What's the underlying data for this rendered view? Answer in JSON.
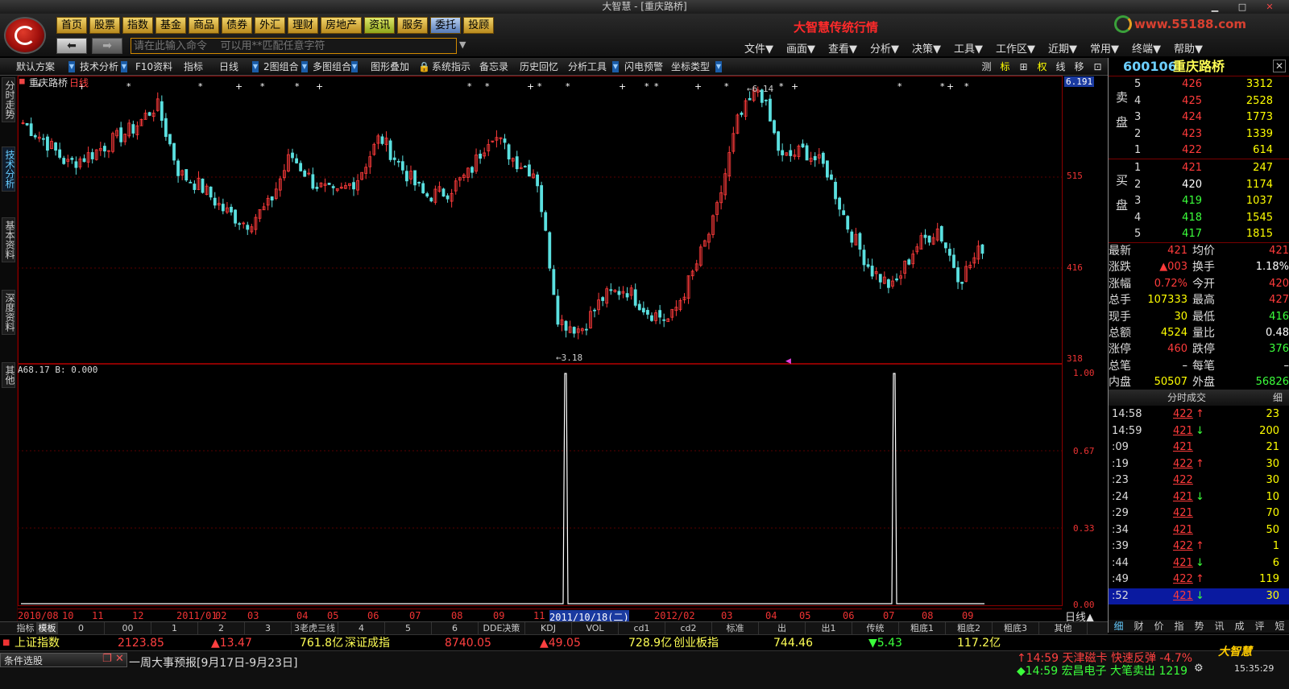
{
  "window": {
    "title": "大智慧 - [重庆路桥]"
  },
  "header": {
    "nav": [
      "首页",
      "股票",
      "指数",
      "基金",
      "商品",
      "债券",
      "外汇",
      "理财",
      "房地产",
      "资讯",
      "服务",
      "委托",
      "投顾"
    ],
    "command_placeholder": "请在此输入命令    可以用**匹配任意字符",
    "brand_title": "大智慧传统行情",
    "site": "www.55188.com",
    "menu": [
      "文件▼",
      "画面▼",
      "查看▼",
      "分析▼",
      "决策▼",
      "工具▼",
      "工作区▼",
      "近期▼",
      "常用▼",
      "终端▼",
      "帮助▼"
    ]
  },
  "toolbar": {
    "items": [
      "默认方案",
      "技术分析",
      "F10资料",
      "指标",
      "日线",
      "2图组合",
      "多图组合",
      "图形叠加",
      "系统指示",
      "备忘录",
      "历史回忆",
      "分析工具",
      "闪电预警",
      "坐标类型"
    ],
    "right_items": [
      "测",
      "标",
      "⊞",
      "权",
      "线",
      "移",
      "⊡",
      "◧"
    ]
  },
  "side_tabs": [
    "分时走势",
    "技术分析",
    "基本资料",
    "深度资料",
    "其他"
  ],
  "chart": {
    "stock_label": "重庆路桥",
    "period_label": "日线",
    "price_axis": [
      "6.191",
      "515",
      "416",
      "318"
    ],
    "high_label": "6.14",
    "low_label": "3.18",
    "indicator_label": "A68.17 B: 0.000",
    "indicator_axis": [
      "1.00",
      "0.67",
      "0.33",
      "0.00"
    ],
    "dates": [
      "2010/08",
      "10",
      "11",
      "12",
      "2011/01",
      "02",
      "03",
      "04",
      "05",
      "06",
      "07",
      "08",
      "09",
      "11",
      "2011/10/18(二)",
      "2012/02",
      "03",
      "04",
      "05",
      "06",
      "07",
      "08",
      "09"
    ],
    "bottom_period": "日线▲"
  },
  "chart_data": {
    "type": "candlestick",
    "title": "重庆路桥 日线",
    "x_range": [
      "2010/08",
      "2012/09"
    ],
    "price_range_shown": [
      3.18,
      6.191
    ],
    "marked_high": 6.14,
    "marked_low": 3.18,
    "y_ticks": [
      "6.191",
      "515",
      "416",
      "318"
    ],
    "close_points": [
      5.75,
      5.55,
      5.3,
      5.4,
      5.55,
      5.7,
      5.95,
      5.2,
      5.05,
      4.8,
      4.65,
      4.85,
      5.4,
      5.1,
      4.95,
      5.15,
      5.6,
      5.25,
      4.95,
      5.0,
      5.2,
      5.65,
      5.35,
      5.2,
      3.6,
      3.5,
      3.85,
      3.95,
      3.7,
      3.6,
      4.1,
      4.7,
      5.75,
      6.14,
      5.35,
      5.45,
      5.25,
      4.6,
      4.15,
      3.95,
      4.4,
      4.6,
      4.05,
      4.4
    ],
    "indicator": {
      "series": [
        {
          "name": "A",
          "spikes_at": [
            "2011/10/18",
            "2012/07"
          ],
          "range": [
            0,
            1
          ]
        }
      ]
    }
  },
  "panel": {
    "code": "600106",
    "name": "重庆路桥",
    "sell_label": "卖盘",
    "buy_label": "买盘",
    "sell": [
      {
        "lvl": "5",
        "price": "426",
        "vol": "3312"
      },
      {
        "lvl": "4",
        "price": "425",
        "vol": "2528"
      },
      {
        "lvl": "3",
        "price": "424",
        "vol": "1773"
      },
      {
        "lvl": "2",
        "price": "423",
        "vol": "1339"
      },
      {
        "lvl": "1",
        "price": "422",
        "vol": "614"
      }
    ],
    "buy": [
      {
        "lvl": "1",
        "price": "421",
        "vol": "247"
      },
      {
        "lvl": "2",
        "price": "420",
        "vol": "1174"
      },
      {
        "lvl": "3",
        "price": "419",
        "vol": "1037"
      },
      {
        "lvl": "4",
        "price": "418",
        "vol": "1545"
      },
      {
        "lvl": "5",
        "price": "417",
        "vol": "1815"
      }
    ],
    "quote": [
      {
        "k1": "最新",
        "v1": "421",
        "k2": "均价",
        "v2": "421"
      },
      {
        "k1": "涨跌",
        "v1": "▲003",
        "k2": "换手",
        "v2": "1.18%"
      },
      {
        "k1": "涨幅",
        "v1": "0.72%",
        "k2": "今开",
        "v2": "420"
      },
      {
        "k1": "总手",
        "v1": "107333",
        "k2": "最高",
        "v2": "427"
      },
      {
        "k1": "现手",
        "v1": "30",
        "k2": "最低",
        "v2": "416"
      },
      {
        "k1": "总额",
        "v1": "4524",
        "k2": "量比",
        "v2": "0.48"
      },
      {
        "k1": "涨停",
        "v1": "460",
        "k2": "跌停",
        "v2": "376"
      },
      {
        "k1": "总笔",
        "v1": "–",
        "k2": "每笔",
        "v2": "–"
      },
      {
        "k1": "内盘",
        "v1": "50507",
        "k2": "外盘",
        "v2": "56826"
      }
    ],
    "tick_header": "分时成交",
    "tick_header_right": "细",
    "ticks": [
      {
        "t": "14:58",
        "p": "422",
        "d": "up",
        "v": "23"
      },
      {
        "t": "14:59",
        "p": "421",
        "d": "down",
        "v": "200"
      },
      {
        "t": ":09",
        "p": "421",
        "d": "",
        "v": "21"
      },
      {
        "t": ":19",
        "p": "422",
        "d": "up",
        "v": "30"
      },
      {
        "t": ":23",
        "p": "422",
        "d": "",
        "v": "30"
      },
      {
        "t": ":24",
        "p": "421",
        "d": "down",
        "v": "10"
      },
      {
        "t": ":29",
        "p": "421",
        "d": "",
        "v": "70"
      },
      {
        "t": ":34",
        "p": "421",
        "d": "",
        "v": "50"
      },
      {
        "t": ":39",
        "p": "422",
        "d": "up",
        "v": "1"
      },
      {
        "t": ":44",
        "p": "421",
        "d": "down",
        "v": "6"
      },
      {
        "t": ":49",
        "p": "422",
        "d": "up",
        "v": "119"
      },
      {
        "t": ":52",
        "p": "421",
        "d": "down",
        "v": "30"
      }
    ],
    "tabs": [
      "细",
      "财",
      "价",
      "指",
      "势",
      "讯",
      "成",
      "评",
      "短"
    ]
  },
  "bottom_tabs": [
    "指标",
    "模板",
    "0",
    "00",
    "1",
    "2",
    "3",
    "3老虎三线",
    "4",
    "5",
    "6",
    "DDE决策",
    "KDJ",
    "VOL",
    "cd1",
    "cd2",
    "标准",
    "出",
    "出1",
    "传统",
    "粗底1",
    "粗底2",
    "粗底3",
    "其他"
  ],
  "status": {
    "idx1_name": "上证指数",
    "idx1_val": "2123.85",
    "idx1_chg": "▲13.47",
    "idx1_amt": "761.8亿",
    "idx2_name": "深证成指",
    "idx2_val": "8740.05",
    "idx2_chg": "▲49.05",
    "idx2_amt": "728.9亿",
    "idx3_name": "创业板指",
    "idx3_val": "744.46",
    "idx3_chg": "▼5.43",
    "idx3_amt": "117.2亿"
  },
  "bottom": {
    "cond_label": "条件选股",
    "news": "一周大事预报[9月17日-9月23日]",
    "alert1": "↑14:59 天津磁卡 快速反弹 -4.7%",
    "alert2": "◆14:59 宏昌电子 大笔卖出 1219",
    "logo": "大智慧",
    "clock": "15:35:29"
  },
  "colors": {
    "up": "#ff3b3b",
    "down": "#3bff3b",
    "flat": "#ffffff",
    "accent": "#ffff00",
    "blue": "#6ccfff"
  }
}
